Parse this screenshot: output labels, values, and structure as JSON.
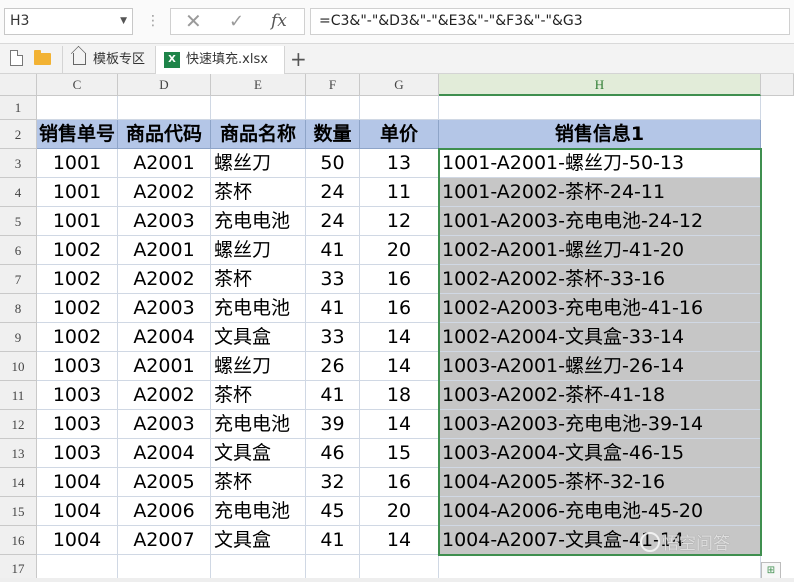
{
  "formula_bar": {
    "name_box": "H3",
    "formula": "=C3&\"-\"&D3&\"-\"&E3&\"-\"&F3&\"-\"&G3",
    "fx_label": "fx"
  },
  "tabs": {
    "template_tab": "模板专区",
    "file_tab": "快速填充.xlsx",
    "file_icon_text": "X",
    "add_label": "+"
  },
  "columns": [
    "C",
    "D",
    "E",
    "F",
    "G",
    "H"
  ],
  "row_numbers": [
    "1",
    "2",
    "3",
    "4",
    "5",
    "6",
    "7",
    "8",
    "9",
    "10",
    "11",
    "12",
    "13",
    "14",
    "15",
    "16",
    "17"
  ],
  "headers": [
    "销售单号",
    "商品代码",
    "商品名称",
    "数量",
    "单价",
    "销售信息1"
  ],
  "rows": [
    [
      "1001",
      "A2001",
      "螺丝刀",
      "50",
      "13",
      "1001-A2001-螺丝刀-50-13"
    ],
    [
      "1001",
      "A2002",
      "茶杯",
      "24",
      "11",
      "1001-A2002-茶杯-24-11"
    ],
    [
      "1001",
      "A2003",
      "充电电池",
      "24",
      "12",
      "1001-A2003-充电电池-24-12"
    ],
    [
      "1002",
      "A2001",
      "螺丝刀",
      "41",
      "20",
      "1002-A2001-螺丝刀-41-20"
    ],
    [
      "1002",
      "A2002",
      "茶杯",
      "33",
      "16",
      "1002-A2002-茶杯-33-16"
    ],
    [
      "1002",
      "A2003",
      "充电电池",
      "41",
      "16",
      "1002-A2003-充电电池-41-16"
    ],
    [
      "1002",
      "A2004",
      "文具盒",
      "33",
      "14",
      "1002-A2004-文具盒-33-14"
    ],
    [
      "1003",
      "A2001",
      "螺丝刀",
      "26",
      "14",
      "1003-A2001-螺丝刀-26-14"
    ],
    [
      "1003",
      "A2002",
      "茶杯",
      "41",
      "18",
      "1003-A2002-茶杯-41-18"
    ],
    [
      "1003",
      "A2003",
      "充电电池",
      "39",
      "14",
      "1003-A2003-充电电池-39-14"
    ],
    [
      "1003",
      "A2004",
      "文具盒",
      "46",
      "15",
      "1003-A2004-文具盒-46-15"
    ],
    [
      "1004",
      "A2005",
      "茶杯",
      "32",
      "16",
      "1004-A2005-茶杯-32-16"
    ],
    [
      "1004",
      "A2006",
      "充电电池",
      "45",
      "20",
      "1004-A2006-充电电池-45-20"
    ],
    [
      "1004",
      "A2007",
      "文具盒",
      "41",
      "14",
      "1004-A2007-文具盒-41-14"
    ]
  ],
  "watermark": "悟空问答",
  "colors": {
    "header_fill": "#b4c6e7",
    "selection_fill": "#c6c6c6",
    "selection_border": "#3f8f4f"
  }
}
